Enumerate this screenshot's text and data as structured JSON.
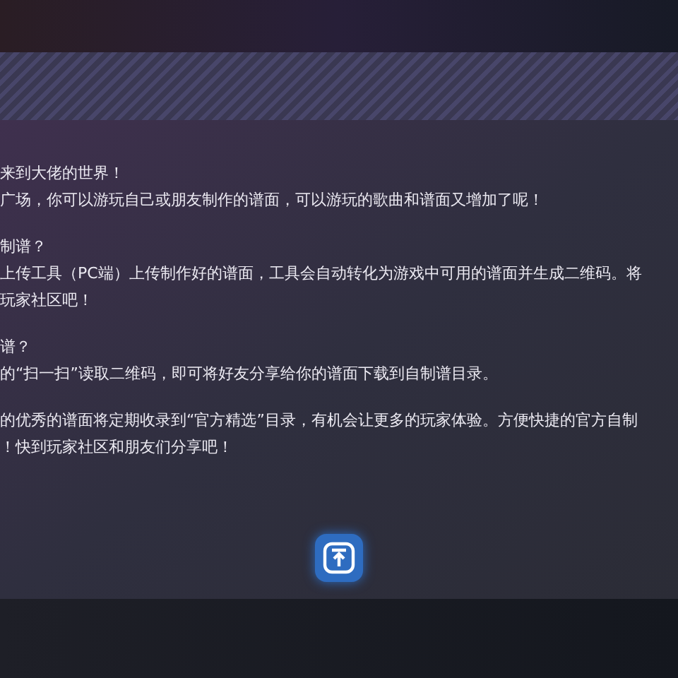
{
  "paragraphs": [
    {
      "lines": [
        "来到大佬的世界！",
        "广场，你可以游玩自己或朋友制作的谱面，可以游玩的歌曲和谱面又增加了呢！"
      ]
    },
    {
      "lines": [
        "制谱？",
        "上传工具（PC端）上传制作好的谱面，工具会自动转化为游戏中可用的谱面并生成二维码。将",
        "玩家社区吧！"
      ]
    },
    {
      "lines": [
        "谱？",
        "的“扫一扫”读取二维码，即可将好友分享给你的谱面下载到自制谱目录。"
      ]
    },
    {
      "lines": [
        "的优秀的谱面将定期收录到“官方精选”目录，有机会让更多的玩家体验。方便快捷的官方自制",
        "！快到玩家社区和朋友们分享吧！"
      ]
    }
  ]
}
